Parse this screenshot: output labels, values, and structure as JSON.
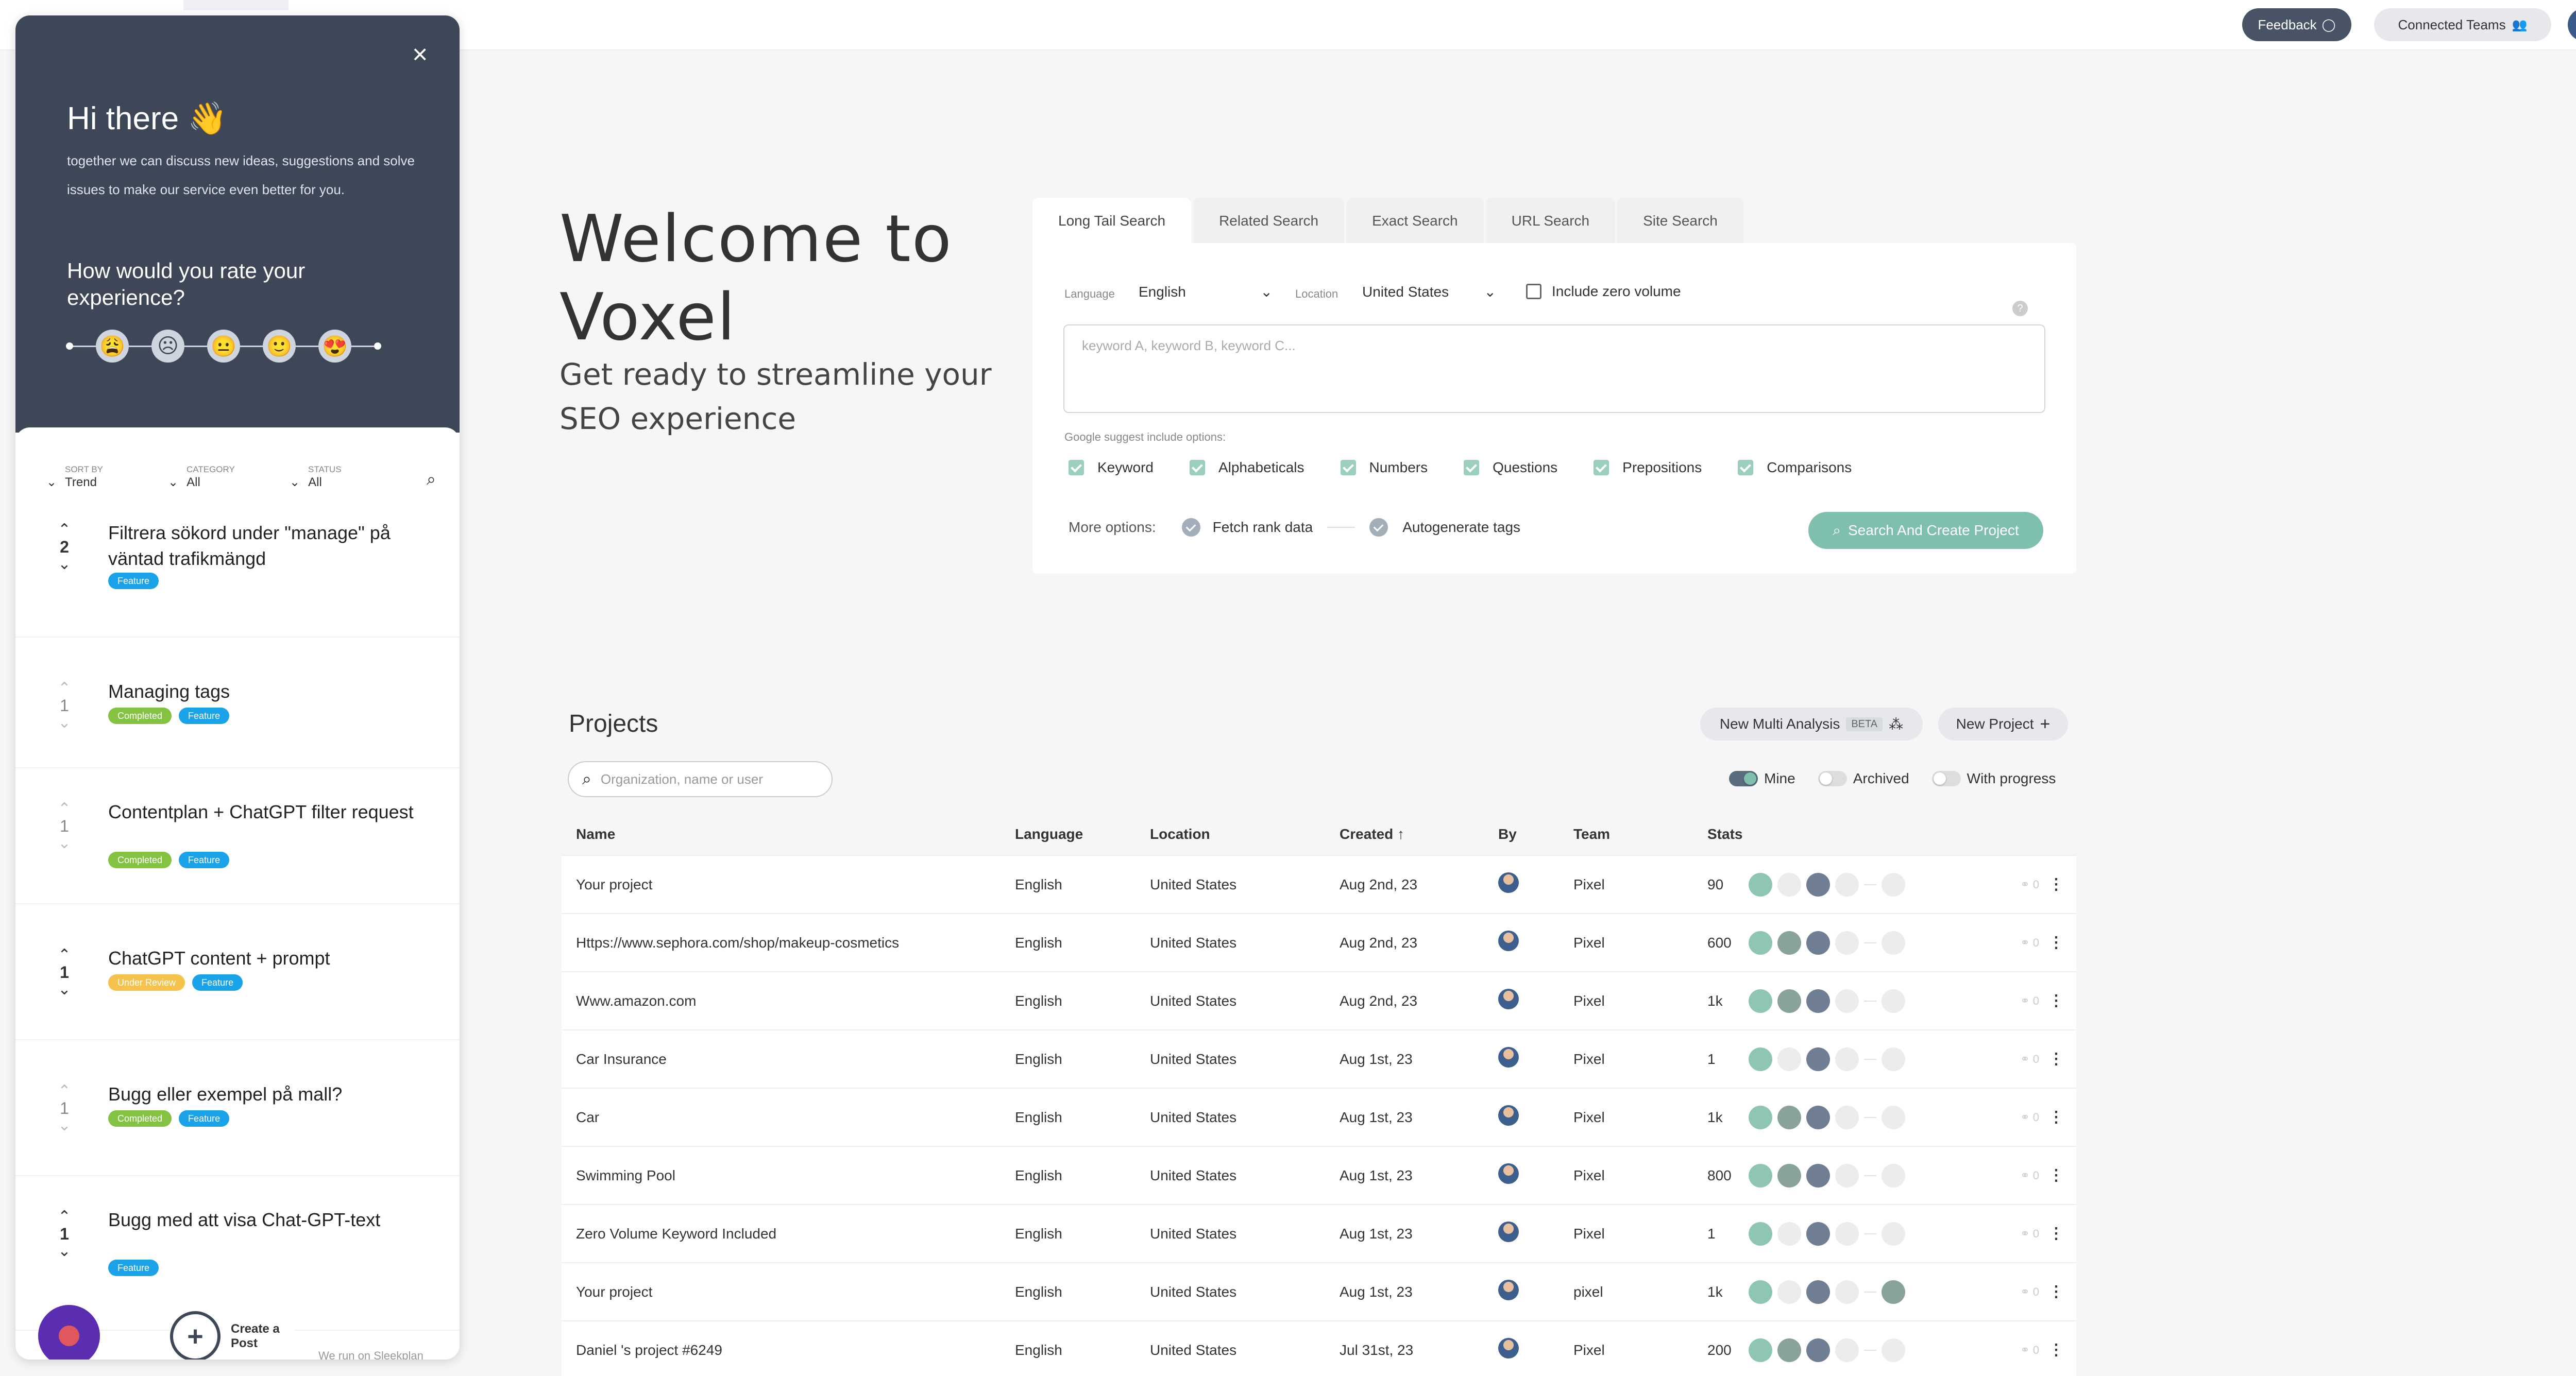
{
  "topbar": {
    "feedback_label": "Feedback",
    "teams_label": "Connected Teams"
  },
  "hero": {
    "title_line1": "Welcome to",
    "title_line2": "Voxel",
    "subtitle": "Get ready to streamline your SEO experience"
  },
  "search": {
    "tabs": [
      "Long Tail Search",
      "Related Search",
      "Exact Search",
      "URL Search",
      "Site Search"
    ],
    "active_tab": "Long Tail Search",
    "language_label": "Language",
    "language_value": "English",
    "location_label": "Location",
    "location_value": "United States",
    "zero_volume_label": "Include zero volume",
    "keywords_placeholder": "keyword A, keyword B, keyword C...",
    "suggest_label": "Google suggest include options:",
    "suggest_options": [
      "Keyword",
      "Alphabeticals",
      "Numbers",
      "Questions",
      "Prepositions",
      "Comparisons"
    ],
    "more_label": "More options:",
    "fetch_rank_label": "Fetch rank data",
    "autogen_tags_label": "Autogenerate tags",
    "submit_label": "Search And Create Project"
  },
  "projects": {
    "title": "Projects",
    "multi_label": "New Multi Analysis",
    "beta_label": "BETA",
    "new_label": "New Project",
    "search_placeholder": "Organization, name or user",
    "toggles": {
      "mine": "Mine",
      "archived": "Archived",
      "progress": "With progress"
    },
    "columns": {
      "name": "Name",
      "language": "Language",
      "location": "Location",
      "created": "Created",
      "by": "By",
      "team": "Team",
      "stats": "Stats"
    },
    "rows": [
      {
        "name": "Your project",
        "language": "English",
        "location": "United States",
        "created": "Aug 2nd, 23",
        "team": "Pixel",
        "stats": "90"
      },
      {
        "name": "Https://www.sephora.com/shop/makeup-cosmetics",
        "language": "English",
        "location": "United States",
        "created": "Aug 2nd, 23",
        "team": "Pixel",
        "stats": "600"
      },
      {
        "name": "Www.amazon.com",
        "language": "English",
        "location": "United States",
        "created": "Aug 2nd, 23",
        "team": "Pixel",
        "stats": "1k"
      },
      {
        "name": "Car Insurance",
        "language": "English",
        "location": "United States",
        "created": "Aug 1st, 23",
        "team": "Pixel",
        "stats": "1"
      },
      {
        "name": "Car",
        "language": "English",
        "location": "United States",
        "created": "Aug 1st, 23",
        "team": "Pixel",
        "stats": "1k"
      },
      {
        "name": "Swimming Pool",
        "language": "English",
        "location": "United States",
        "created": "Aug 1st, 23",
        "team": "Pixel",
        "stats": "800"
      },
      {
        "name": "Zero Volume Keyword Included",
        "language": "English",
        "location": "United States",
        "created": "Aug 1st, 23",
        "team": "Pixel",
        "stats": "1"
      },
      {
        "name": "Your project",
        "language": "English",
        "location": "United States",
        "created": "Aug 1st, 23",
        "team": "pixel",
        "stats": "1k"
      },
      {
        "name": "Daniel 's project #6249",
        "language": "English",
        "location": "United States",
        "created": "Jul 31st, 23",
        "team": "Pixel",
        "stats": "200"
      }
    ]
  },
  "feedback_panel": {
    "greeting": "Hi there 👋",
    "intro": "together we can discuss new ideas, suggestions and solve issues to make our service even better for you.",
    "rate_question": "How would you rate your experience?",
    "faces": [
      "😩",
      "☹",
      "😐",
      "🙂",
      "😍"
    ],
    "filters": [
      {
        "key": "SORT BY",
        "value": "Trend"
      },
      {
        "key": "CATEGORY",
        "value": "All"
      },
      {
        "key": "STATUS",
        "value": "All"
      }
    ],
    "posts": [
      {
        "votes": "2",
        "title": "Filtrera sökord under \"manage\" på väntad trafikmängd",
        "badges": [
          "Feature"
        ]
      },
      {
        "votes": "1",
        "title": "Managing tags",
        "badges": [
          "Completed",
          "Feature"
        ]
      },
      {
        "votes": "1",
        "title": "Contentplan + ChatGPT filter request",
        "badges": [
          "Completed",
          "Feature"
        ]
      },
      {
        "votes": "1",
        "title": "ChatGPT content + prompt",
        "badges": [
          "Under Review",
          "Feature"
        ]
      },
      {
        "votes": "1",
        "title": "Bugg eller exempel på mall?",
        "badges": [
          "Completed",
          "Feature"
        ]
      },
      {
        "votes": "1",
        "title": "Bugg med att visa Chat-GPT-text",
        "badges": [
          "Feature"
        ]
      }
    ],
    "create_label": "Create a Post",
    "run_on": "We run on Sleekplan"
  }
}
